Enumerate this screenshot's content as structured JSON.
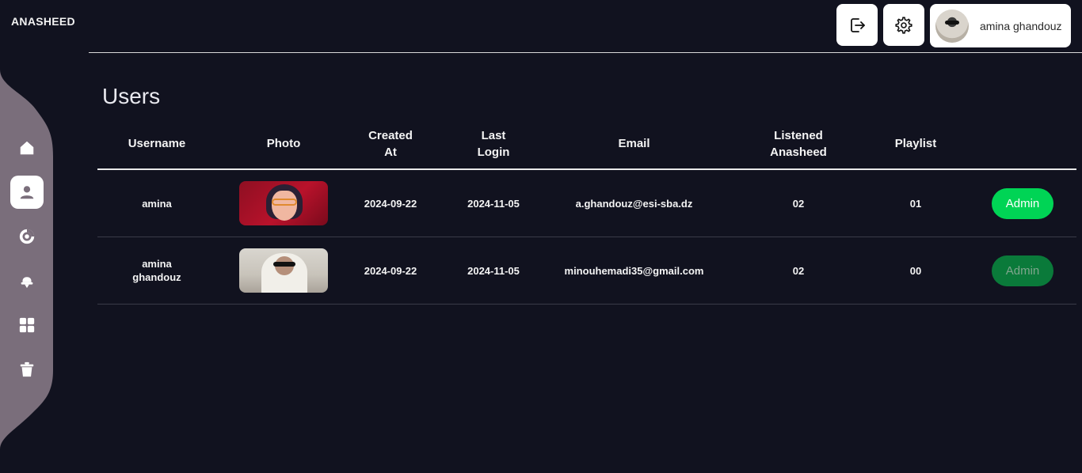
{
  "app": {
    "brand": "ANASHEED"
  },
  "sidebar": {
    "items": [
      {
        "name": "home",
        "icon": "home-icon",
        "active": false
      },
      {
        "name": "users",
        "icon": "user-icon",
        "active": true
      },
      {
        "name": "albums",
        "icon": "disc-icon",
        "active": false
      },
      {
        "name": "microphone",
        "icon": "microphone-icon",
        "active": false
      },
      {
        "name": "categories",
        "icon": "grid-icon",
        "active": false
      },
      {
        "name": "trash",
        "icon": "trash-icon",
        "active": false
      }
    ]
  },
  "header": {
    "logout_icon": "logout-icon",
    "settings_icon": "gear-icon",
    "profile": {
      "name": "amina ghandouz"
    }
  },
  "page": {
    "title": "Users"
  },
  "table": {
    "columns": {
      "username": "Username",
      "photo": "Photo",
      "created": "Created At",
      "last_login": "Last Login",
      "email": "Email",
      "listened": "Listened Anasheed",
      "playlist": "Playlist"
    },
    "rows": [
      {
        "username": "amina",
        "created": "2024-09-22",
        "last_login": "2024-11-05",
        "email": "a.ghandouz@esi-sba.dz",
        "listened": "02",
        "playlist": "01",
        "role": "Admin",
        "role_active": true
      },
      {
        "username": "amina ghandouz",
        "created": "2024-09-22",
        "last_login": "2024-11-05",
        "email": "minouhemadi35@gmail.com",
        "listened": "02",
        "playlist": "00",
        "role": "Admin",
        "role_active": false
      }
    ]
  },
  "colors": {
    "background": "#11121f",
    "sidebar": "#7a6e7b",
    "role_active": "#00d455",
    "role_inactive": "#0a7a3a"
  }
}
